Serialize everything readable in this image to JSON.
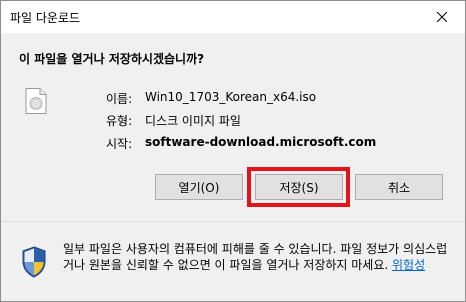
{
  "window": {
    "title": "파일 다운로드"
  },
  "dialog": {
    "question": "이 파일을 열거나 저장하시겠습니까?",
    "file": {
      "name_label": "이름:",
      "name_value": "Win10_1703_Korean_x64.iso",
      "type_label": "유형:",
      "type_value": "디스크 이미지 파일",
      "from_label": "시작:",
      "from_value": "software-download.microsoft.com"
    },
    "buttons": {
      "open": "열기(O)",
      "save": "저장(S)",
      "cancel": "취소"
    },
    "warning": {
      "text": "일부 파일은 사용자의 컴퓨터에 피해를 줄 수 있습니다. 파일 정보가 의심스럽거나 원본을 신뢰할 수 없으면 이 파일을 열거나 저장하지 마세요.",
      "link": "위험성"
    }
  },
  "colors": {
    "highlight": "#e3141c",
    "link": "#0066cc",
    "dialog_bg": "#f0f0f0"
  },
  "icons": {
    "close": "close-icon",
    "file": "disc-image-file-icon",
    "shield": "security-shield-icon"
  }
}
